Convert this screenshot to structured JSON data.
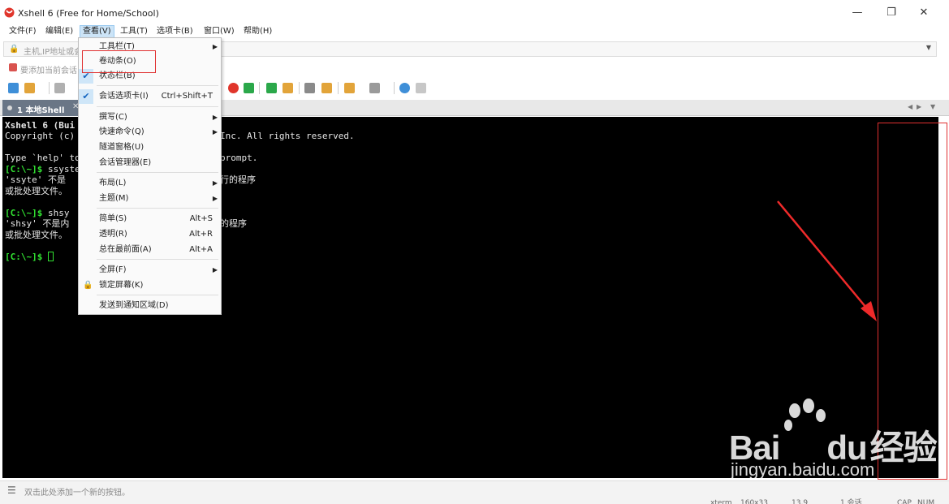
{
  "window": {
    "title": "Xshell 6 (Free for Home/School)",
    "controls": {
      "minimize": "—",
      "restore": "❐",
      "close": "✕"
    }
  },
  "menubar": {
    "items": [
      {
        "label": "文件(F)"
      },
      {
        "label": "编辑(E)"
      },
      {
        "label": "查看(V)",
        "active": true
      },
      {
        "label": "工具(T)"
      },
      {
        "label": "选项卡(B)"
      },
      {
        "label": "窗口(W)"
      },
      {
        "label": "帮助(H)"
      }
    ]
  },
  "address_bar": {
    "placeholder": "主机,IP地址或会",
    "lock_icon": "lock-icon"
  },
  "link_bar": {
    "text": "要添加当前会话"
  },
  "tab": {
    "label": "1 本地Shell",
    "close": "✕"
  },
  "terminal": {
    "lines": [
      "Xshell 6 (Bui",
      "Copyright (c)",
      "",
      "Type `help' to",
      "[C:\\~]$ ssyste",
      "'ssyte' 不是",
      "或批处理文件。",
      "",
      "[C:\\~]$ shsy",
      "'shsy' 不是内",
      "或批处理文件。",
      "",
      "[C:\\~]$ "
    ],
    "right_fragments": {
      "copyright_tail": "Inc. All rights reserved.",
      "help_tail": "prompt.",
      "err1_tail": "行的程序",
      "err2_tail": "的程序"
    }
  },
  "view_menu": {
    "items": [
      {
        "label": "工具栏(T)",
        "submenu": true
      },
      {
        "label": "卷动条(O)"
      },
      {
        "label": "状态栏(B)",
        "checked": true
      },
      {
        "label": "会话选项卡(I)",
        "checked": true,
        "shortcut": "Ctrl+Shift+T"
      },
      {
        "label": "撰写(C)",
        "submenu": true
      },
      {
        "label": "快速命令(Q)",
        "submenu": true
      },
      {
        "label": "隧道窗格(U)"
      },
      {
        "label": "会话管理器(E)"
      },
      {
        "label": "布局(L)",
        "submenu": true
      },
      {
        "label": "主题(M)",
        "submenu": true
      },
      {
        "label": "简单(S)",
        "shortcut": "Alt+S"
      },
      {
        "label": "透明(R)",
        "shortcut": "Alt+R"
      },
      {
        "label": "总在最前面(A)",
        "shortcut": "Alt+A"
      },
      {
        "label": "全屏(F)",
        "submenu": true
      },
      {
        "label": "锁定屏幕(K)",
        "lock": true
      },
      {
        "label": "发送到通知区域(D)"
      }
    ]
  },
  "quick_bar": {
    "text": "双击此处添加一个新的按钮。"
  },
  "status_bar": {
    "items": [
      "xterm",
      "160x33",
      "13,9",
      "1 会话",
      "CAP",
      "NUM"
    ]
  },
  "watermark": {
    "brand": "Bai",
    "brand_du": "du",
    "brand_cn": "经验",
    "url": "jingyan.baidu.com"
  },
  "colors": {
    "annotation": "#e03030",
    "prompt": "#32e332",
    "tab": "#6a7686"
  }
}
